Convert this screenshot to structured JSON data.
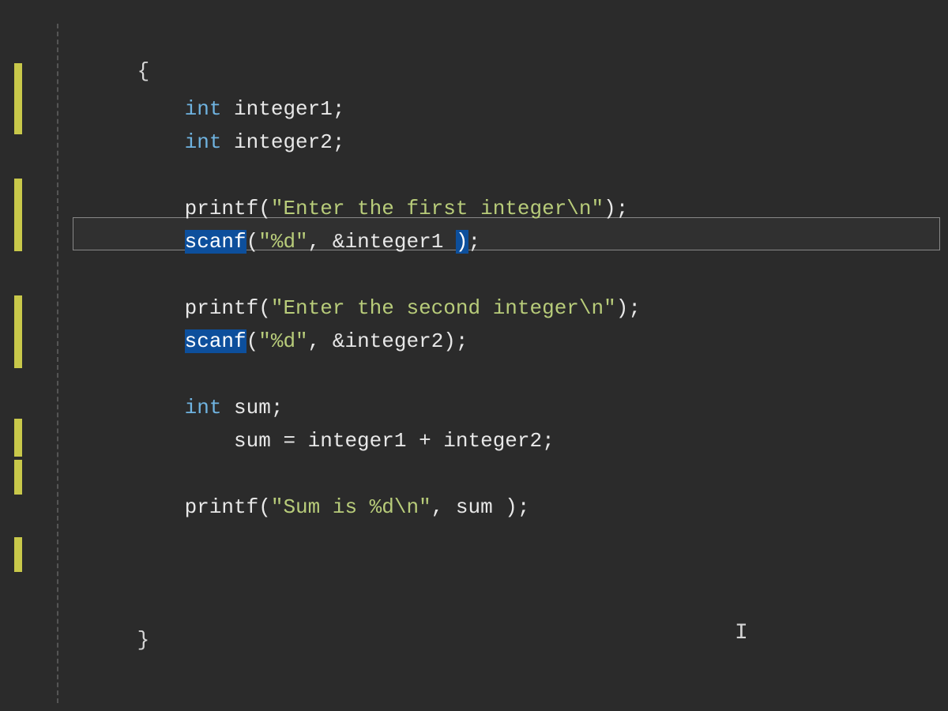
{
  "code": {
    "brace_open": "{",
    "brace_close": "}",
    "line1_kw": "int",
    "line1_sp": " ",
    "line1_id": "integer1;",
    "line2_kw": "int",
    "line2_sp": " ",
    "line2_id": "integer2;",
    "line3_fn": "printf(",
    "line3_str": "\"Enter the first integer\\n\"",
    "line3_end": ");",
    "line4_sel": "scanf",
    "line4_paren": "(",
    "line4_str": "\"%d\"",
    "line4_mid": ", &integer1 ",
    "line4_sel2": ")",
    "line4_end": ";",
    "line5_fn": "printf(",
    "line5_str": "\"Enter the second integer\\n\"",
    "line5_end": ");",
    "line6_sel": "scanf",
    "line6_paren": "(",
    "line6_str": "\"%d\"",
    "line6_end": ", &integer2);",
    "line7_kw": "int",
    "line7_sp": " ",
    "line7_id": "sum;",
    "line8_txt": "    sum = integer1 + integer2;",
    "line9_fn": "printf(",
    "line9_str": "\"Sum is %d\\n\"",
    "line9_end": ", sum );"
  },
  "caret": "I"
}
